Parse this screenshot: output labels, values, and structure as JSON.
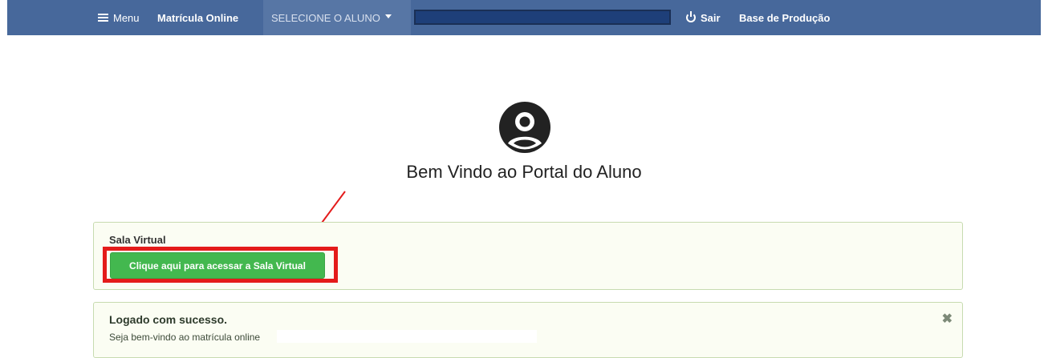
{
  "navbar": {
    "menu_label": "Menu",
    "matricula_label": "Matrícula Online",
    "select_label": "SELECIONE O ALUNO",
    "sair_label": "Sair",
    "base_label": "Base de Produção",
    "colors": {
      "background": "#47689b",
      "select_bg": "#5776a5",
      "redacted": "#1e3f79"
    }
  },
  "header": {
    "avatar_icon": "user-circle-icon",
    "welcome": "Bem Vindo ao Portal do Aluno"
  },
  "sala_virtual": {
    "title": "Sala Virtual",
    "button_label": "Clique aqui para acessar a Sala Virtual",
    "colors": {
      "button": "#43b84f",
      "highlight": "#e41b1b",
      "annotation_arrow": "#e41b1b"
    }
  },
  "alert": {
    "title": "Logado com sucesso.",
    "message": "Seja bem-vindo ao matrícula online",
    "close_icon": "close-icon"
  }
}
